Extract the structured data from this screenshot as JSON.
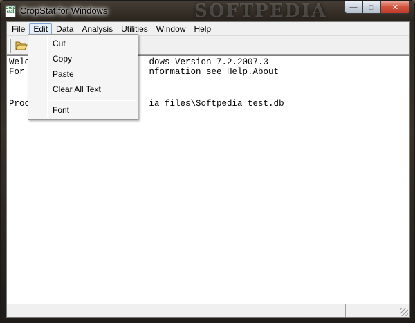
{
  "window": {
    "title": "CropStat for Windows",
    "watermark": "SOFTPEDIA",
    "icon_name": "cropstat-app-icon",
    "controls": {
      "minimize": "minimize-icon",
      "maximize": "maximize-icon",
      "close": "close-icon"
    }
  },
  "menubar": {
    "items": [
      {
        "label": "File"
      },
      {
        "label": "Edit",
        "open": true
      },
      {
        "label": "Data"
      },
      {
        "label": "Analysis"
      },
      {
        "label": "Utilities"
      },
      {
        "label": "Window"
      },
      {
        "label": "Help"
      }
    ]
  },
  "toolbar": {
    "open_icon": "folder-open-icon"
  },
  "edit_menu": {
    "items": [
      {
        "label": "Cut"
      },
      {
        "label": "Copy"
      },
      {
        "label": "Paste"
      },
      {
        "label": "Clear All Text"
      },
      {
        "label": "Font"
      }
    ]
  },
  "content": {
    "lines": [
      "Welcome to CropStat for Windows Version 7.2.2007.3",
      "For more information see Help.About",
      "",
      "Processing C:\\Softpedia files\\Softpedia test.db"
    ],
    "visible_lines": [
      "Welc                       dows Version 7.2.2007.3",
      "For                        nformation see Help.About",
      "",
      "Proc                       ia files\\Softpedia test.db"
    ]
  },
  "colors": {
    "menu_highlight_border": "#7ea1d2",
    "close_button": "#c0392b",
    "client_bg": "#f0f0f0"
  }
}
